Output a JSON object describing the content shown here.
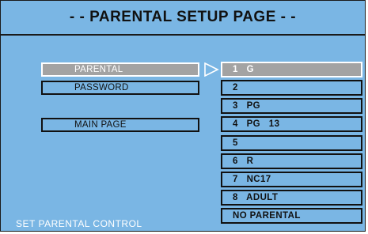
{
  "header": {
    "title": "- - PARENTAL SETUP PAGE - -"
  },
  "menu": {
    "items": [
      {
        "label": "PARENTAL",
        "selected": true
      },
      {
        "label": "PASSWORD",
        "selected": false
      },
      {
        "label": "MAIN PAGE",
        "selected": false
      }
    ]
  },
  "options": {
    "items": [
      {
        "label": "1   G",
        "selected": true
      },
      {
        "label": "2",
        "selected": false
      },
      {
        "label": "3   PG",
        "selected": false
      },
      {
        "label": "4   PG   13",
        "selected": false
      },
      {
        "label": "5",
        "selected": false
      },
      {
        "label": "6   R",
        "selected": false
      },
      {
        "label": "7   NC17",
        "selected": false
      },
      {
        "label": "8   ADULT",
        "selected": false
      },
      {
        "label": "NO PARENTAL",
        "selected": false
      }
    ]
  },
  "status": {
    "text": "SET PARENTAL CONTROL"
  },
  "icons": {
    "pointer": "right-triangle-arrow-icon"
  },
  "colors": {
    "background": "#7ab6e4",
    "selected_bg": "#a3a3a3",
    "border": "#111111",
    "selected_text": "#ffffff"
  }
}
